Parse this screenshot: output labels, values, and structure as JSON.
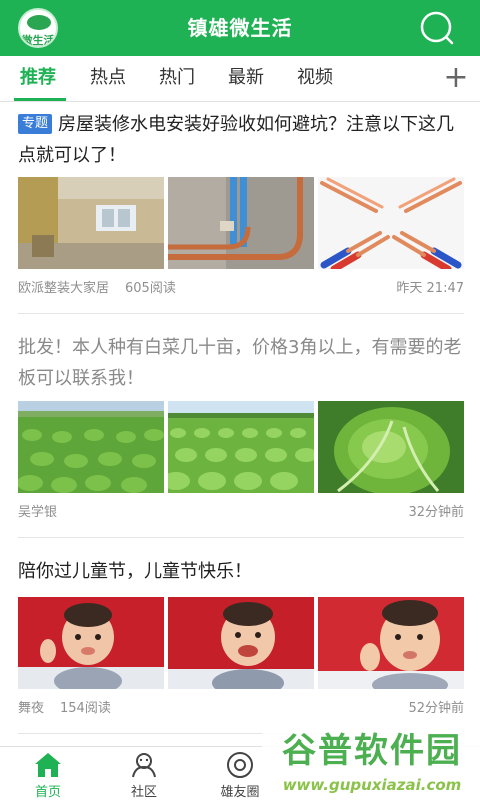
{
  "header": {
    "logo_text": "微生活",
    "title": "镇雄微生活",
    "color": "#1fb254"
  },
  "tabs": [
    {
      "label": "推荐",
      "active": true
    },
    {
      "label": "热点"
    },
    {
      "label": "热门"
    },
    {
      "label": "最新"
    },
    {
      "label": "视频"
    }
  ],
  "tab_add_label": "+",
  "feed": [
    {
      "tag": "专题",
      "title": "房屋装修水电安装好验收如何避坑？注意以下这几点就可以了！",
      "source": "欧派整装大家居",
      "reads": "605阅读",
      "time": "昨天 21:47",
      "images": [
        "毛坯房室内",
        "墙内水电管线",
        "红蓝电线"
      ]
    },
    {
      "title": "批发！本人种有白菜几十亩，价格3角以上，有需要的老板可以联系我！",
      "source": "吴学银",
      "time": "32分钟前",
      "images": [
        "白菜地",
        "白菜田垄",
        "白菜特写"
      ]
    },
    {
      "title": "陪你过儿童节，儿童节快乐！",
      "source": "舞夜",
      "reads": "154阅读",
      "time": "52分钟前",
      "images": [
        "儿童照片1",
        "儿童照片2",
        "儿童照片3"
      ]
    }
  ],
  "bottom_nav": [
    {
      "label": "首页",
      "icon": "home-icon",
      "active": true
    },
    {
      "label": "社区",
      "icon": "community-icon"
    },
    {
      "label": "雄友圈",
      "icon": "circle-icon"
    }
  ],
  "watermark": {
    "main": "谷普软件园",
    "url": "www.gupuxiazai.com"
  }
}
